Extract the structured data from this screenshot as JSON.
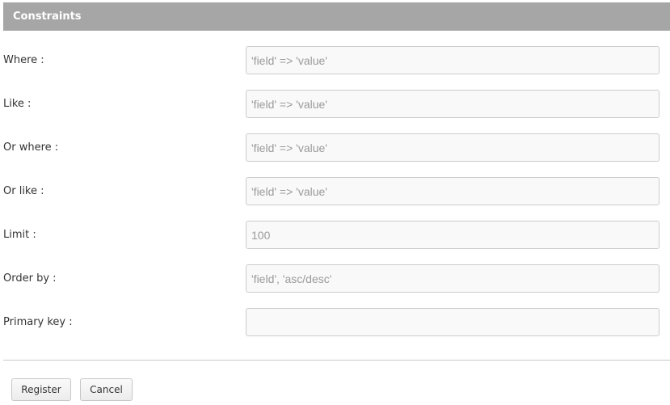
{
  "section": {
    "title": "Constraints"
  },
  "fields": [
    {
      "label": "Where :",
      "placeholder": "'field' => 'value'",
      "value": ""
    },
    {
      "label": "Like :",
      "placeholder": "'field' => 'value'",
      "value": ""
    },
    {
      "label": "Or where :",
      "placeholder": "'field' => 'value'",
      "value": ""
    },
    {
      "label": "Or like :",
      "placeholder": "'field' => 'value'",
      "value": ""
    },
    {
      "label": "Limit :",
      "placeholder": "100",
      "value": ""
    },
    {
      "label": "Order by :",
      "placeholder": "'field', 'asc/desc'",
      "value": ""
    },
    {
      "label": "Primary key :",
      "placeholder": "",
      "value": ""
    }
  ],
  "actions": {
    "register_label": "Register",
    "cancel_label": "Cancel"
  }
}
